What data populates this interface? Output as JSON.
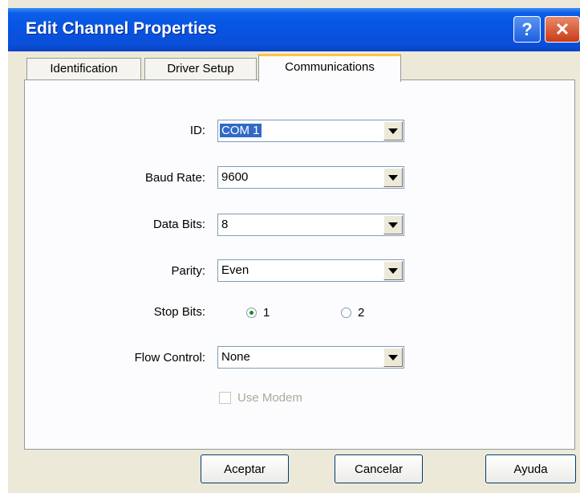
{
  "window": {
    "title": "Edit Channel Properties",
    "help_button": "?",
    "close_button": "✕"
  },
  "tabs": [
    {
      "label": "Identification",
      "active": false
    },
    {
      "label": "Driver Setup",
      "active": false
    },
    {
      "label": "Communications",
      "active": true
    }
  ],
  "form": {
    "id": {
      "label": "ID:",
      "value": "COM 1"
    },
    "baud_rate": {
      "label": "Baud Rate:",
      "value": "9600"
    },
    "data_bits": {
      "label": "Data Bits:",
      "value": "8"
    },
    "parity": {
      "label": "Parity:",
      "value": "Even"
    },
    "stop_bits": {
      "label": "Stop Bits:",
      "options": [
        "1",
        "2"
      ],
      "selected": "1"
    },
    "flow_control": {
      "label": "Flow Control:",
      "value": "None"
    },
    "use_modem": {
      "label": "Use Modem",
      "checked": false,
      "enabled": false
    }
  },
  "buttons": {
    "ok": "Aceptar",
    "cancel": "Cancelar",
    "help": "Ayuda"
  }
}
